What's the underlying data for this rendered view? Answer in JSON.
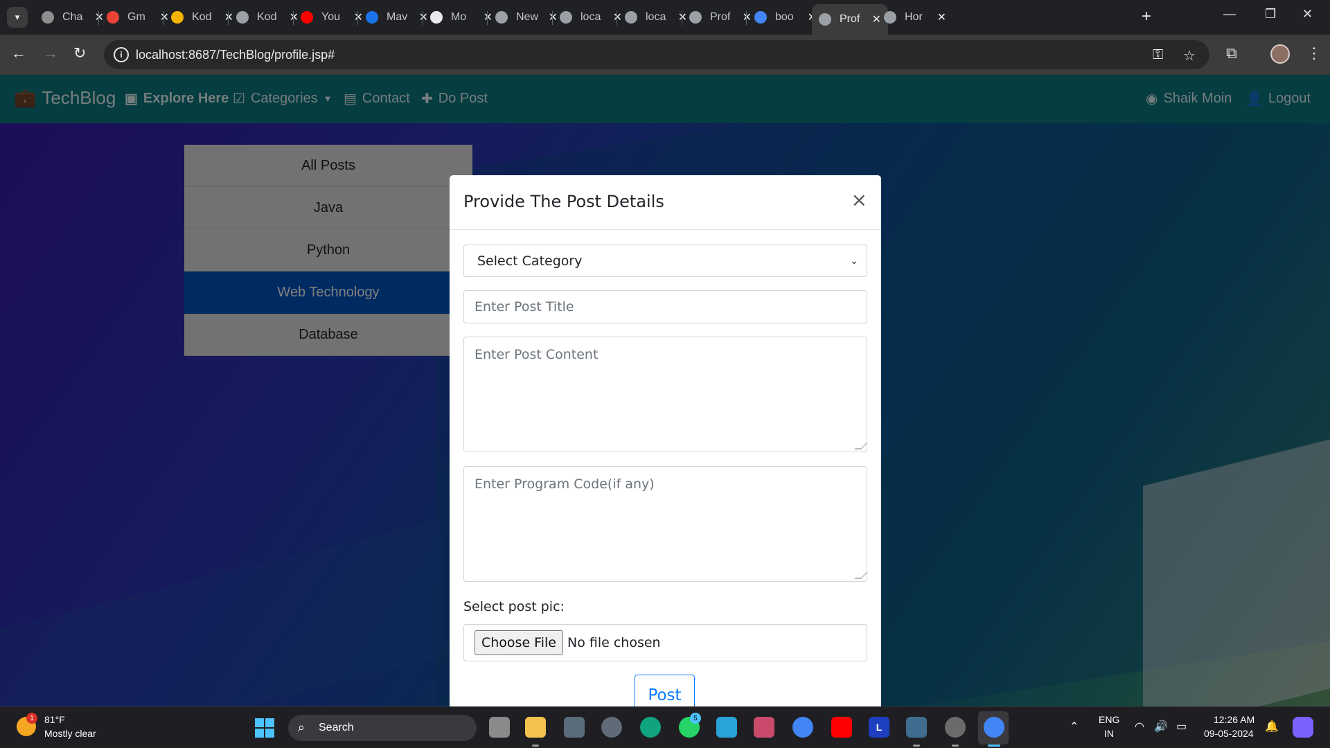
{
  "browser": {
    "tabs": [
      {
        "title": "Cha",
        "icon": "chatgpt-icon",
        "color": "#8e8e8e"
      },
      {
        "title": "Gm",
        "icon": "gmail-icon",
        "color": "#ea4335"
      },
      {
        "title": "Kod",
        "icon": "kodnest-icon",
        "color": "#f4b400"
      },
      {
        "title": "Kod",
        "icon": "globe-icon",
        "color": "#9aa0a6"
      },
      {
        "title": "You",
        "icon": "youtube-icon",
        "color": "#ff0000"
      },
      {
        "title": "Mav",
        "icon": "maven-icon",
        "color": "#1a73e8"
      },
      {
        "title": "Mo",
        "icon": "github-icon",
        "color": "#e8eaed"
      },
      {
        "title": "New",
        "icon": "chrome-icon",
        "color": "#9aa0a6"
      },
      {
        "title": "loca",
        "icon": "globe-icon",
        "color": "#9aa0a6"
      },
      {
        "title": "loca",
        "icon": "globe-icon",
        "color": "#9aa0a6"
      },
      {
        "title": "Prof",
        "icon": "globe-icon",
        "color": "#9aa0a6"
      },
      {
        "title": "boo",
        "icon": "google-icon",
        "color": "#4285f4"
      },
      {
        "title": "Prof",
        "icon": "globe-icon",
        "color": "#9aa0a6",
        "active": true
      },
      {
        "title": "Hor",
        "icon": "globe-icon",
        "color": "#9aa0a6"
      }
    ],
    "url": "localhost:8687/TechBlog/profile.jsp#"
  },
  "navbar": {
    "brand": "TechBlog",
    "items": [
      "Explore Here",
      "Categories",
      "Contact",
      "Do Post"
    ],
    "user": "Shaik Moin",
    "logout": "Logout",
    "color": "#0a7a80"
  },
  "sidebar": {
    "categories": [
      "All Posts",
      "Java",
      "Python",
      "Web Technology",
      "Database"
    ],
    "active": "Web Technology"
  },
  "modal": {
    "title": "Provide The Post Details",
    "close": "×",
    "category_select": "Select Category",
    "title_placeholder": "Enter Post Title",
    "content_placeholder": "Enter Post Content",
    "code_placeholder": "Enter Program Code(if any)",
    "pic_label": "Select post pic:",
    "file_button": "Choose File",
    "file_status": "No file chosen",
    "submit": "Post"
  },
  "taskbar": {
    "weather_temp": "81°F",
    "weather_desc": "Mostly clear",
    "weather_badge": "1",
    "search": "Search",
    "whatsapp_badge": "5",
    "lang_line1": "ENG",
    "lang_line2": "IN",
    "time": "12:26 AM",
    "date": "09-05-2024"
  }
}
